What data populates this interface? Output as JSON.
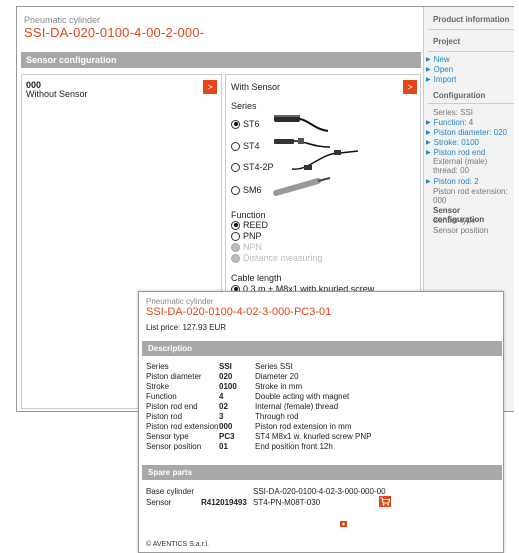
{
  "product": {
    "kind": "Pneumatic cylinder",
    "code": "SSI-DA-020-0100-4-00-2-000-"
  },
  "config": {
    "section_title": "Sensor configuration",
    "left_option": {
      "code": "000",
      "name": "Without Sensor"
    },
    "right_option": {
      "name": "With Sensor"
    },
    "series_label": "Series",
    "series_options": [
      {
        "label": "ST6",
        "selected": true
      },
      {
        "label": "ST4",
        "selected": false
      },
      {
        "label": "ST4-2P",
        "selected": false
      },
      {
        "label": "SM6",
        "selected": false
      }
    ],
    "function_label": "Function",
    "function_options": [
      {
        "label": "REED",
        "selected": true,
        "disabled": false
      },
      {
        "label": "PNP",
        "selected": false,
        "disabled": false
      },
      {
        "label": "NPN",
        "selected": false,
        "disabled": true
      },
      {
        "label": "Distance measuring",
        "selected": false,
        "disabled": true
      }
    ],
    "cable_label": "Cable length",
    "cable_option": "0.3 m + M8x1 with knurled screw",
    "arrow_glyph": ">"
  },
  "sidebar": {
    "product_info": "Product information",
    "project": "Project",
    "project_links": [
      "New",
      "Open",
      "Import"
    ],
    "configuration": "Configuration",
    "series": "Series: SSI",
    "function": "Function: 4",
    "piston_diameter": "Piston diameter: 020",
    "stroke": "Stroke: 0100",
    "piston_rod_end": "Piston rod end",
    "piston_rod_end_value": "External (male) thread: 00",
    "piston_rod": "Piston rod: 2",
    "piston_rod_ext": "Piston rod extension: 000",
    "sensor_config": "Sensor configuration",
    "sensor_type": "Sensor type",
    "sensor_position": "Sensor position"
  },
  "popup": {
    "kind": "Pneumatic cylinder",
    "code": "SSI-DA-020-0100-4-02-3-000-PC3-01",
    "price": "List price: 127.93 EUR",
    "description_title": "Description",
    "rows": [
      {
        "k": "Series",
        "c": "SSI",
        "t": "Series SSI"
      },
      {
        "k": "Piston diameter",
        "c": "020",
        "t": "Diameter 20"
      },
      {
        "k": "Stroke",
        "c": "0100",
        "t": "Stroke in mm"
      },
      {
        "k": "Function",
        "c": "4",
        "t": "Double acting with magnet"
      },
      {
        "k": "Piston rod end",
        "c": "02",
        "t": "Internal (female) thread"
      },
      {
        "k": "Piston rod",
        "c": "3",
        "t": "Through rod"
      },
      {
        "k": "Piston rod extension",
        "c": "000",
        "t": "Piston rod extension in mm"
      },
      {
        "k": "Sensor type",
        "c": "PC3",
        "t": "ST4 M8x1 w. knurled screw PNP"
      },
      {
        "k": "Sensor position",
        "c": "01",
        "t": "End position front 12h"
      }
    ],
    "spare_title": "Spare parts",
    "spare": [
      {
        "k": "Base cylinder",
        "num": "",
        "code": "SSI-DA-020-0100-4-02-3-000-000-00"
      },
      {
        "k": "Sensor",
        "num": "R412019493",
        "code": "ST4-PN-M08T-030"
      }
    ],
    "copyright": "© AVENTICS S.a.r.l."
  },
  "colors": {
    "accent": "#e2461b",
    "bar": "#a8a8a8",
    "link": "#1b86c8"
  },
  "icons": {
    "cart": "cart-icon",
    "arrow": "chevron-right-icon",
    "up": "arrow-up-icon"
  }
}
